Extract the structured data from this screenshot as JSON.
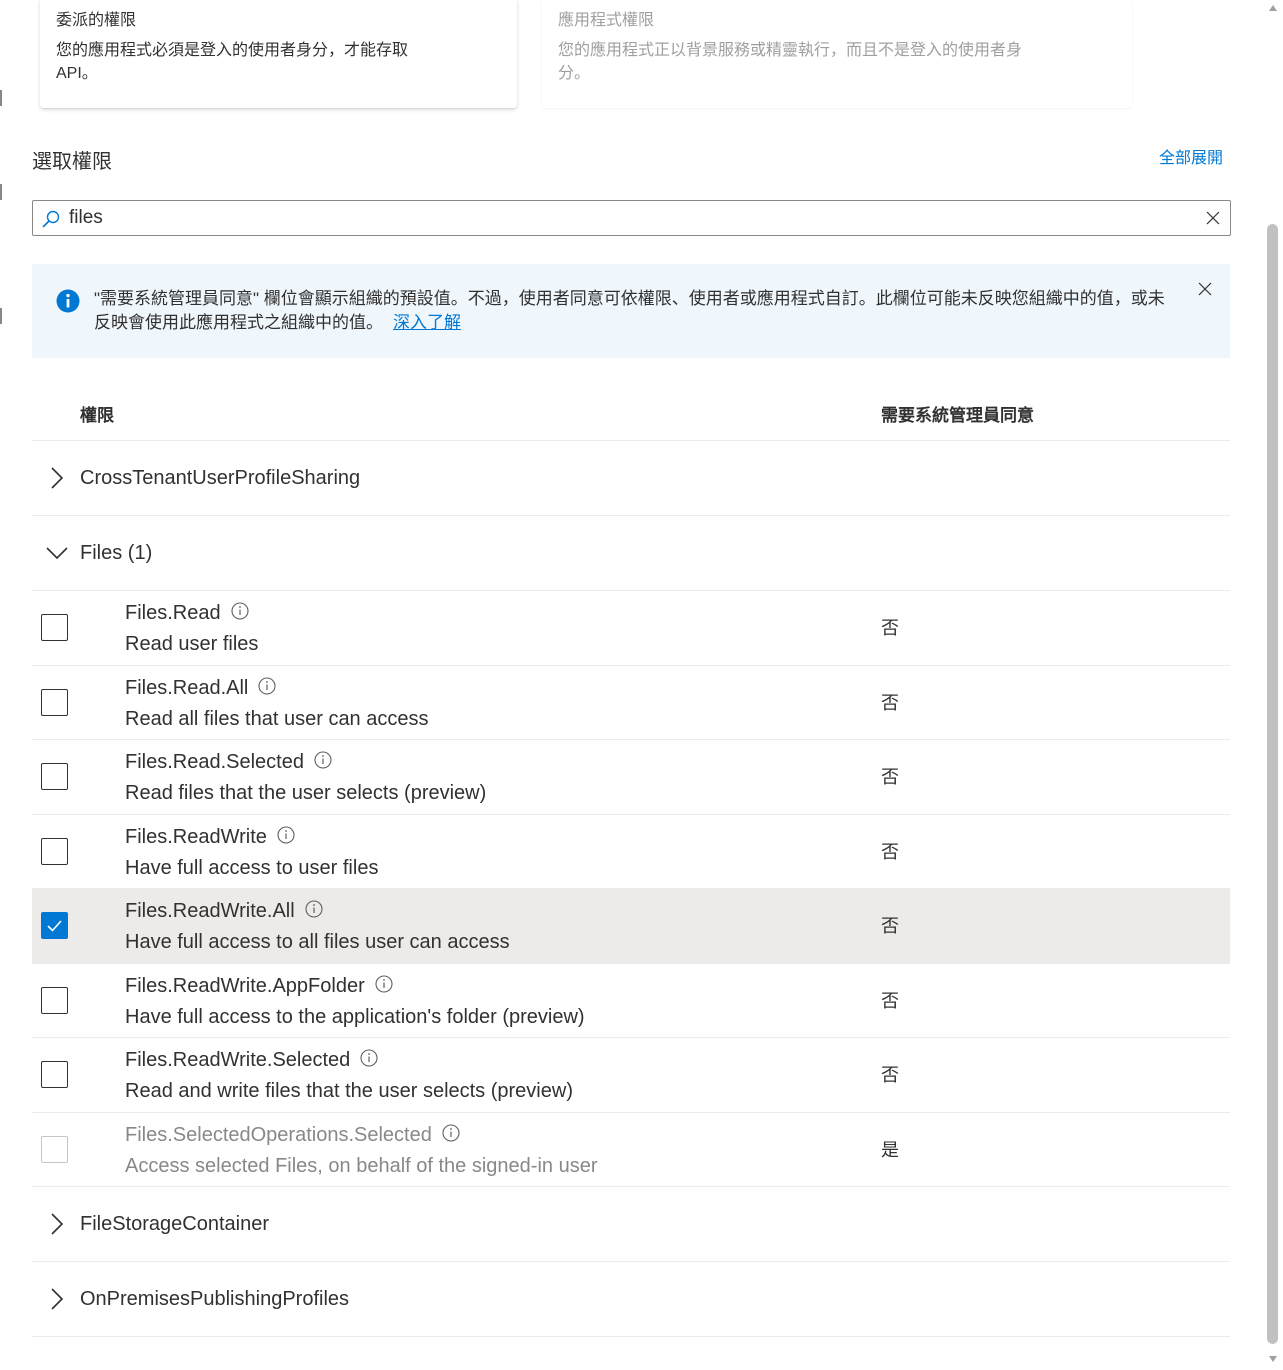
{
  "cards": {
    "delegated": {
      "title": "委派的權限",
      "description": "您的應用程式必須是登入的使用者身分，才能存取 API。"
    },
    "application": {
      "title": "應用程式權限",
      "description": "您的應用程式正以背景服務或精靈執行，而且不是登入的使用者身分。"
    }
  },
  "section": {
    "title": "選取權限",
    "expand_all": "全部展開"
  },
  "search": {
    "value": "files",
    "icon": "search-icon",
    "clear_icon": "dismiss-icon"
  },
  "info_bar": {
    "message": "\"需要系統管理員同意\" 欄位會顯示組織的預設值。不過，使用者同意可依權限、使用者或應用程式自訂。此欄位可能未反映您組織中的值，或未反映會使用此應用程式之組織中的值。",
    "link": "深入了解",
    "icon": "info-icon"
  },
  "table": {
    "headers": {
      "permission": "權限",
      "admin_consent": "需要系統管理員同意"
    },
    "groups_before": [
      {
        "label": "CrossTenantUserProfileSharing",
        "expanded": false
      }
    ],
    "open_group": {
      "label": "Files (1)",
      "expanded": true,
      "permissions": [
        {
          "name": "Files.Read",
          "description": "Read user files",
          "admin_consent": "否",
          "checked": false,
          "disabled": false
        },
        {
          "name": "Files.Read.All",
          "description": "Read all files that user can access",
          "admin_consent": "否",
          "checked": false,
          "disabled": false
        },
        {
          "name": "Files.Read.Selected",
          "description": "Read files that the user selects (preview)",
          "admin_consent": "否",
          "checked": false,
          "disabled": false
        },
        {
          "name": "Files.ReadWrite",
          "description": "Have full access to user files",
          "admin_consent": "否",
          "checked": false,
          "disabled": false
        },
        {
          "name": "Files.ReadWrite.All",
          "description": "Have full access to all files user can access",
          "admin_consent": "否",
          "checked": true,
          "disabled": false
        },
        {
          "name": "Files.ReadWrite.AppFolder",
          "description": "Have full access to the application's folder (preview)",
          "admin_consent": "否",
          "checked": false,
          "disabled": false
        },
        {
          "name": "Files.ReadWrite.Selected",
          "description": "Read and write files that the user selects (preview)",
          "admin_consent": "否",
          "checked": false,
          "disabled": false
        },
        {
          "name": "Files.SelectedOperations.Selected",
          "description": "Access selected Files, on behalf of the signed-in user",
          "admin_consent": "是",
          "checked": false,
          "disabled": true
        }
      ]
    },
    "groups_after": [
      {
        "label": "FileStorageContainer",
        "expanded": false
      },
      {
        "label": "OnPremisesPublishingProfiles",
        "expanded": false
      }
    ]
  },
  "colors": {
    "accent": "#0078d4",
    "info_background": "#eff6fc",
    "selected_row": "#edebe9"
  }
}
